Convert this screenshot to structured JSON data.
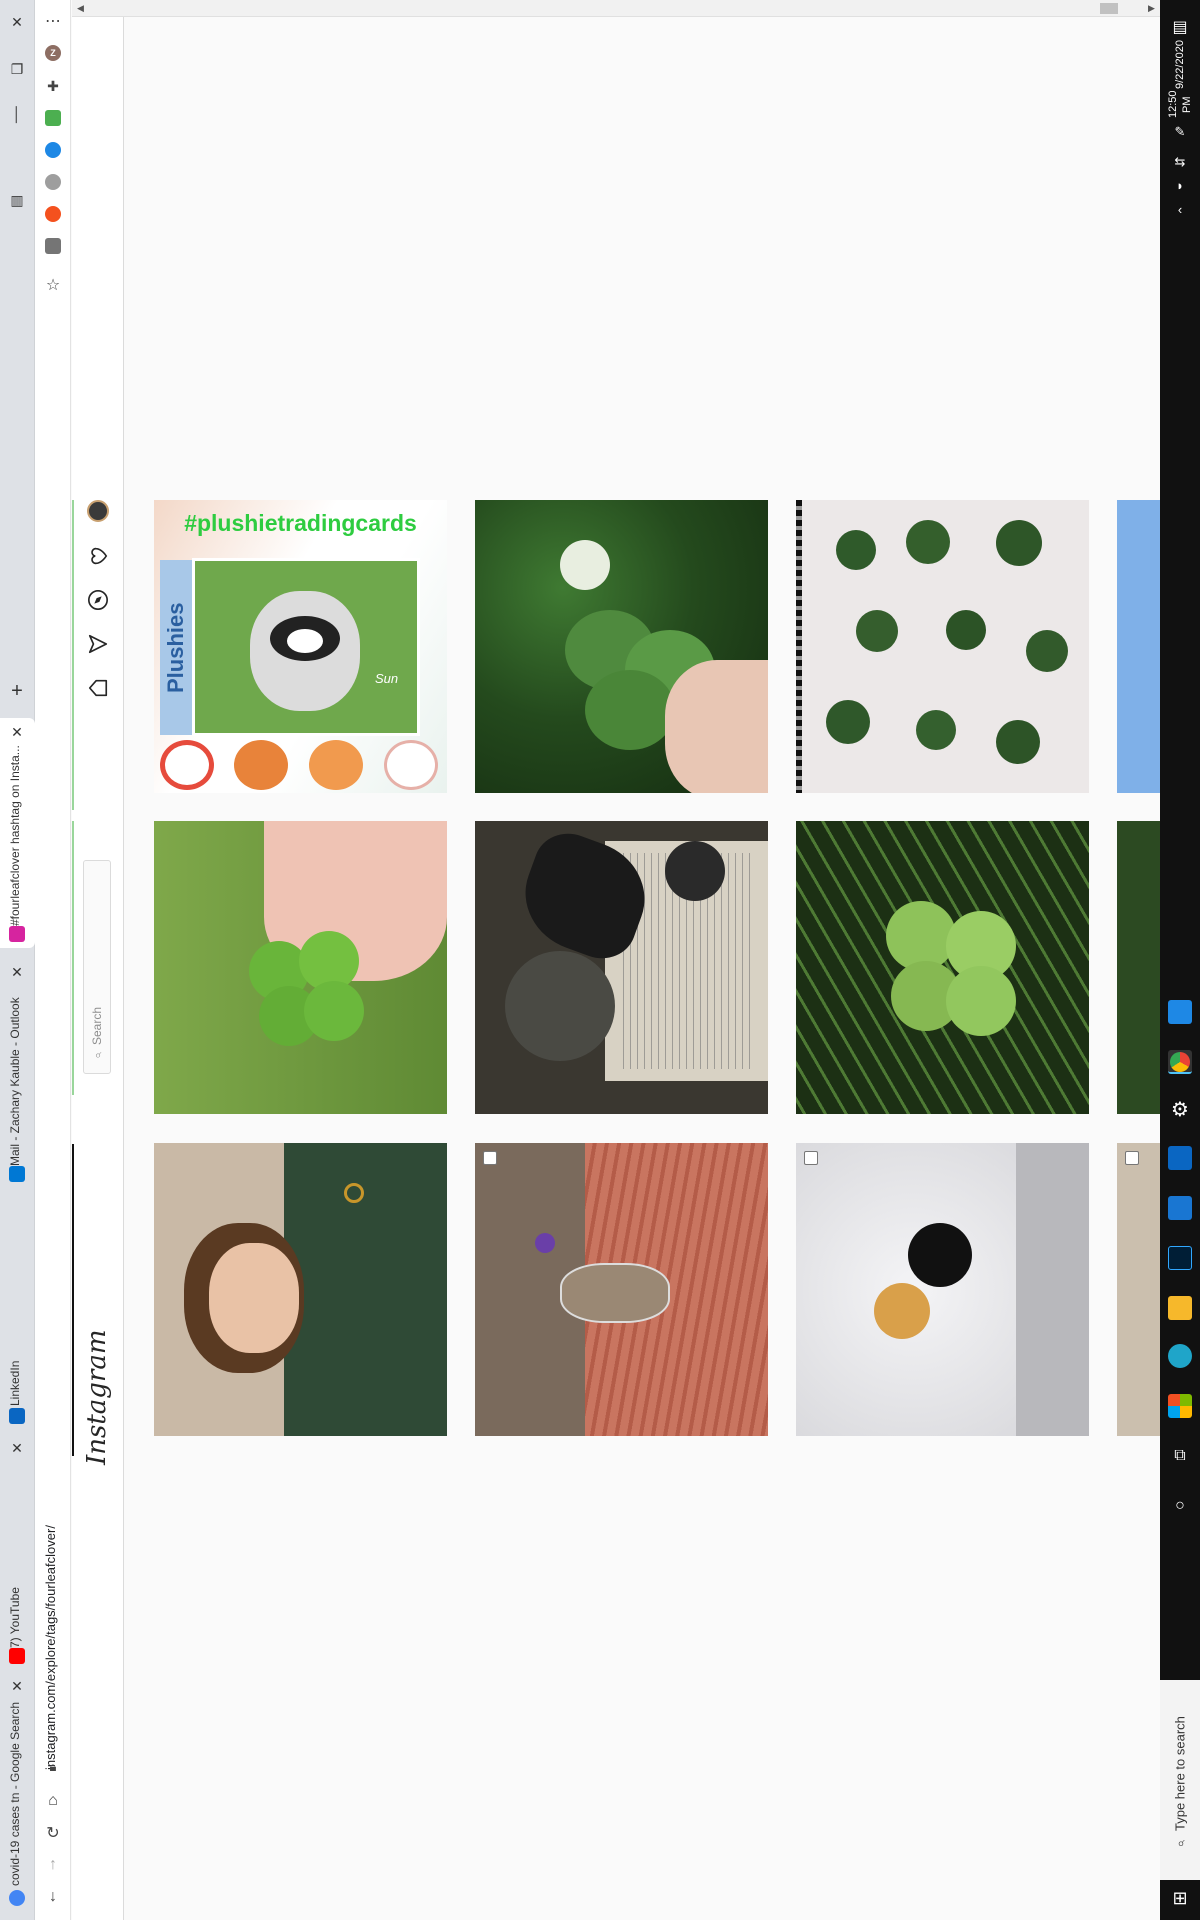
{
  "browser": {
    "tabs": [
      {
        "label": "covid-19 cases tn - Google Search",
        "favicon_color": "#4285f4"
      },
      {
        "label": "(7) YouTube",
        "favicon_color": "#ff0000"
      },
      {
        "label": "LinkedIn",
        "favicon_color": "#0a66c2"
      },
      {
        "label": "Mail - Zachary Kauble - Outlook",
        "favicon_color": "#0078d4"
      },
      {
        "label": "#fourleafclover hashtag on Insta...",
        "favicon_color": "#d6249f"
      }
    ],
    "url": "instagram.com/explore/tags/fourleafclover/",
    "menu_icon": "⋯",
    "profile_initial": "Z"
  },
  "instagram": {
    "logo": "Instagram",
    "search_placeholder": "Search",
    "posts": [
      {
        "id": "p1",
        "overlay_title": "#plushietradingcards",
        "overlay_side": "Plushies",
        "overlay_name": "Sun",
        "has_checkbox": false
      },
      {
        "id": "p2",
        "has_checkbox": false
      },
      {
        "id": "p3",
        "has_checkbox": false
      },
      {
        "id": "p4",
        "has_checkbox": false
      },
      {
        "id": "p5",
        "has_checkbox": false
      },
      {
        "id": "p6",
        "has_checkbox": false
      },
      {
        "id": "p7",
        "has_checkbox": false
      },
      {
        "id": "p8",
        "has_checkbox": false
      },
      {
        "id": "p9",
        "has_checkbox": false
      },
      {
        "id": "p10",
        "has_checkbox": true
      },
      {
        "id": "p11",
        "has_checkbox": true
      },
      {
        "id": "p12",
        "has_checkbox": true
      }
    ]
  },
  "taskbar": {
    "time": "12:50 PM",
    "date": "9/22/2020",
    "search_placeholder": "Type here to search"
  },
  "colors": {
    "clover_green": "#5a9a3c",
    "grass_green": "#7aa04a",
    "dark_green": "#2f4f2f",
    "instagram_border": "#dbdbdb"
  }
}
